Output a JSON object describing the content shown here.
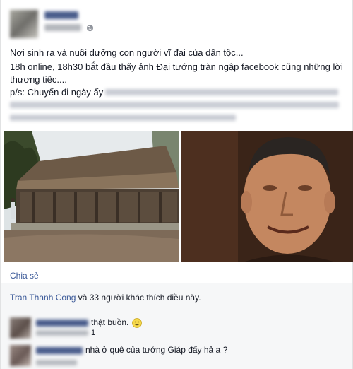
{
  "post": {
    "lines": [
      "Nơi sinh ra và nuôi dưỡng con người vĩ đại của dân tộc...",
      "18h online, 18h30 bắt đầu thấy ảnh Đại tướng tràn ngập facebook cũng những lời",
      "thương tiếc....",
      "p/s: Chuyến đi ngày ấy"
    ]
  },
  "actions": {
    "share_label": "Chia sẻ"
  },
  "likes": {
    "name": "Tran Thanh Cong",
    "rest": " và 33 người khác thích điều này."
  },
  "comments": [
    {
      "text": "thật buồn.",
      "emoji_icon": "smiley-icon",
      "count": "1"
    },
    {
      "text": "nhà ở quê của tướng Giáp đấy hả a ?"
    }
  ],
  "colors": {
    "link": "#3b5998",
    "text": "#141823",
    "footer_bg": "#f6f7f8"
  }
}
